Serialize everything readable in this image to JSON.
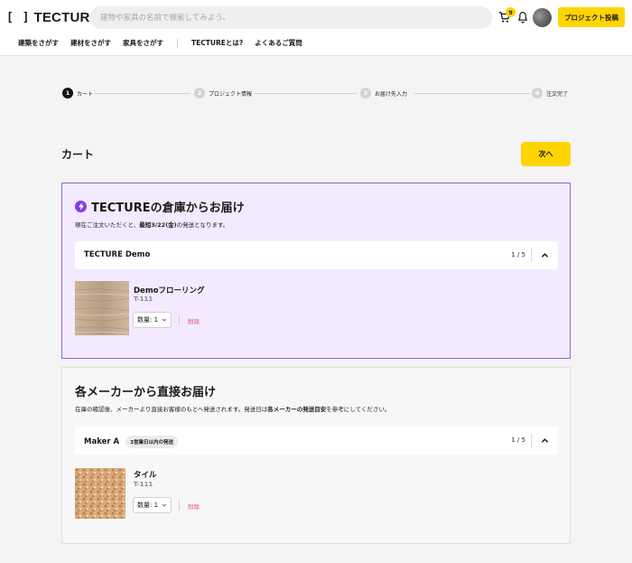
{
  "header": {
    "logo_mark": "[ ]",
    "logo_text": "TECTURE",
    "search_placeholder": "建物や家具の名前で検索してみよう。",
    "cart_badge": "9",
    "post_button": "プロジェクト投稿",
    "nav": [
      "建築をさがす",
      "建材をさがす",
      "家具をさがす",
      "TECTUREとは?",
      "よくあるご質問"
    ]
  },
  "stepper": [
    {
      "num": "1",
      "label": "カート",
      "active": true
    },
    {
      "num": "2",
      "label": "プロジェクト情報",
      "active": false
    },
    {
      "num": "3",
      "label": "お届け先入力",
      "active": false
    },
    {
      "num": "4",
      "label": "注文完了",
      "active": false
    }
  ],
  "page": {
    "title": "カート",
    "next_button": "次へ"
  },
  "warehouse": {
    "title": "TECTUREの倉庫からお届け",
    "desc_pre": "現在ご注文いただくと、",
    "desc_bold": "最短3/22(金)",
    "desc_post": "の発送となります。",
    "group": {
      "name": "TECTURE Demo",
      "count": "1 / 5"
    },
    "item": {
      "name": "Demoフローリング",
      "sku": "T-111",
      "qty": "数量: 1",
      "delete": "削除"
    }
  },
  "maker": {
    "title": "各メーカーから直接お届け",
    "desc_pre": "在庫の確認後、メーカーより直接お客様のもとへ発送されます。発送日は",
    "desc_bold": "各メーカーの発送目安",
    "desc_post": "を参考にしてください。",
    "group": {
      "name": "Maker A",
      "tag": "3営業日以内の発送",
      "count": "1 / 5"
    },
    "item": {
      "name": "タイル",
      "sku": "T-111",
      "qty": "数量: 1",
      "delete": "削除"
    }
  },
  "colors": {
    "accent": "#ffd400",
    "warehouse_bg": "#f3eaff",
    "warehouse_border": "#8d64d6",
    "delete": "#e0566b"
  }
}
